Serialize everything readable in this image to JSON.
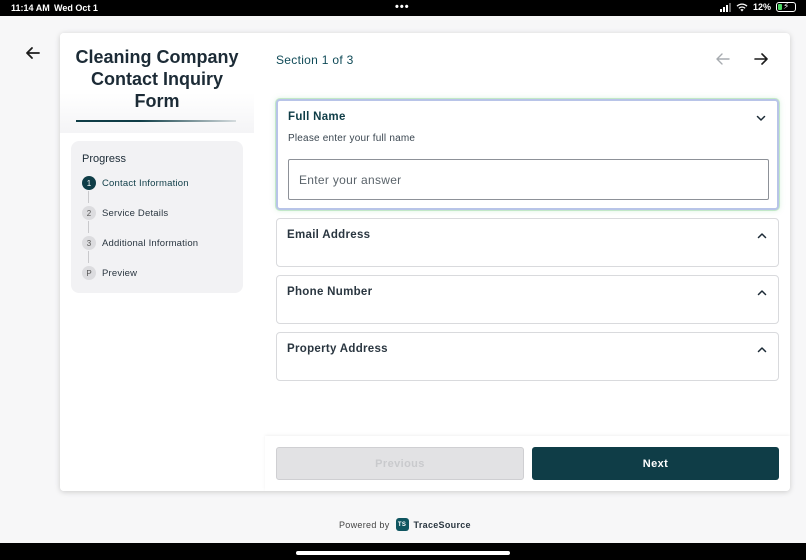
{
  "statusbar": {
    "time": "11:14 AM",
    "date": "Wed Oct 1",
    "dots": "•••",
    "battery": "12%"
  },
  "form": {
    "title": "Cleaning Company Contact Inquiry Form"
  },
  "progress": {
    "title": "Progress",
    "steps": [
      {
        "num": "1",
        "label": "Contact Information",
        "active": true
      },
      {
        "num": "2",
        "label": "Service Details",
        "active": false
      },
      {
        "num": "3",
        "label": "Additional Information",
        "active": false
      },
      {
        "num": "P",
        "label": "Preview",
        "active": false
      }
    ]
  },
  "section": {
    "label": "Section 1 of 3"
  },
  "questions": [
    {
      "title": "Full Name",
      "description": "Please enter your full name",
      "placeholder": "Enter your answer",
      "expanded": true
    },
    {
      "title": "Email Address",
      "expanded": false
    },
    {
      "title": "Phone Number",
      "expanded": false
    },
    {
      "title": "Property Address",
      "expanded": false
    }
  ],
  "buttons": {
    "previous": "Previous",
    "next": "Next"
  },
  "footer": {
    "powered_by": "Powered by",
    "logo_text": "TS",
    "brand": "TraceSource"
  },
  "colors": {
    "primary": "#0f3d47",
    "active_border": "#b8c4e8",
    "disabled_button": "#e2e2e4"
  },
  "icons": [
    "back-arrow-icon",
    "nav-prev-arrow-icon",
    "nav-next-arrow-icon",
    "chevron-down-icon",
    "chevron-up-icon",
    "wifi-icon",
    "signal-icon",
    "battery-icon"
  ]
}
